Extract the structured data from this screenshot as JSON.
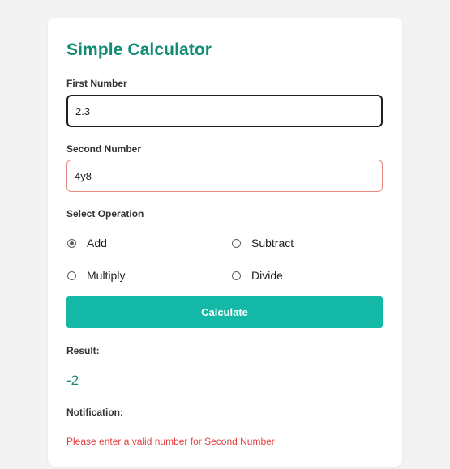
{
  "app": {
    "title": "Simple Calculator"
  },
  "form": {
    "first_label": "First Number",
    "first_value": "2.3",
    "second_label": "Second Number",
    "second_value": "4y8",
    "operation_label": "Select Operation",
    "operations": [
      {
        "label": "Add",
        "checked": true
      },
      {
        "label": "Subtract",
        "checked": false
      },
      {
        "label": "Multiply",
        "checked": false
      },
      {
        "label": "Divide",
        "checked": false
      }
    ],
    "calculate_label": "Calculate"
  },
  "result": {
    "label": "Result:",
    "value": "-2"
  },
  "notification": {
    "label": "Notification:",
    "message": "Please enter a valid number for Second Number"
  },
  "colors": {
    "accent": "#14b8a6",
    "title": "#128b73",
    "error": "#e53e3e",
    "error_border": "#e8877f"
  }
}
